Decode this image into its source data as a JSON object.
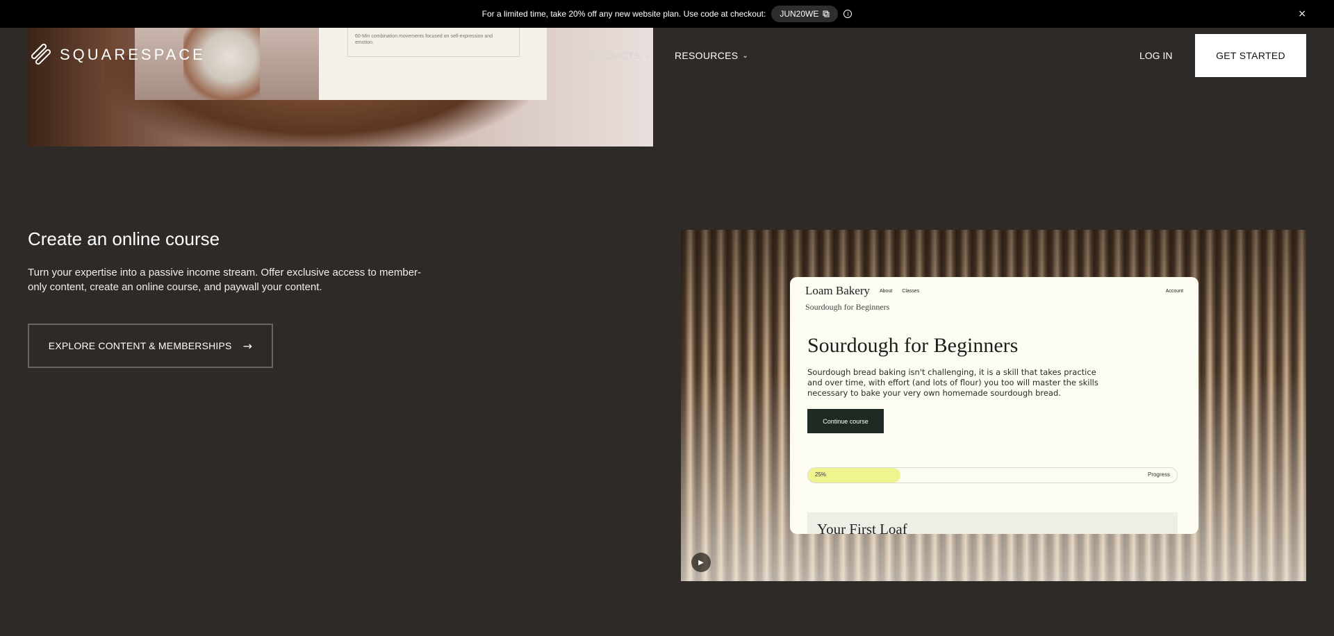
{
  "promo": {
    "message": "For a limited time, take 20% off any new website plan. Use code at checkout:",
    "code": "JUN20WE",
    "copy_icon": "copy-icon",
    "info_icon": "info-icon",
    "close_glyph": "×"
  },
  "hero_image": {
    "card_text": "60-Min combination movements focused on self-expression and emotion."
  },
  "nav": {
    "logo_text": "SQUARESPACE",
    "products_label": "PRODUCTS",
    "resources_label": "RESOURCES",
    "login_label": "LOG IN",
    "cta_label": "GET STARTED"
  },
  "section": {
    "heading": "Create an online course",
    "description": "Turn your expertise into a passive income stream. Offer exclusive access to member-only content, create an online course, and paywall your content.",
    "button_label": "EXPLORE CONTENT & MEMBERSHIPS",
    "button_arrow": "→"
  },
  "mockup": {
    "brand": "Loam Bakery",
    "links": [
      "About",
      "Classes"
    ],
    "account": "Account",
    "breadcrumb": "Sourdough for Beginners",
    "title": "Sourdough for Beginners",
    "body": "Sourdough bread baking isn't challenging, it is a skill that takes practice and over time, with effort (and lots of flour) you too will master the skills necessary to bake your very own homemade sourdough bread.",
    "continue_label": "Continue course",
    "progress_value": 0.25,
    "progress_text": "25%",
    "progress_label": "Progress",
    "lesson_title": "Your First Loaf"
  },
  "video": {
    "play_glyph": "▶"
  },
  "colors": {
    "background": "#2e2a27",
    "promo_bar": "#000000",
    "cta_bg": "#ffffff",
    "progress_fill": "#eef58f"
  }
}
